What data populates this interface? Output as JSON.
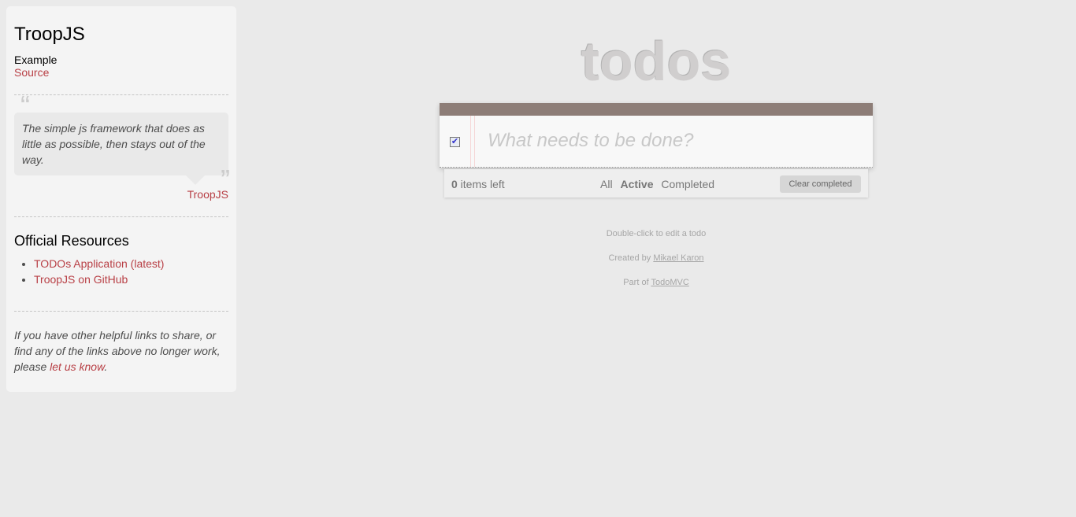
{
  "sidebar": {
    "title": "TroopJS",
    "example_label": "Example",
    "source_link": "Source",
    "quote": "The simple js framework that does as little as possible, then stays out of the way.",
    "quote_author": "TroopJS",
    "resources_heading": "Official Resources",
    "resources": [
      {
        "label": "TODOs Application (latest)"
      },
      {
        "label": "TroopJS on GitHub"
      }
    ],
    "footer_text": "If you have other helpful links to share, or find any of the links above no longer work, please ",
    "footer_link": "let us know",
    "footer_end": "."
  },
  "app": {
    "title": "todos",
    "placeholder": "What needs to be done?",
    "toggle_all_checked": true,
    "count": "0",
    "count_suffix": " items left",
    "filters": [
      "All",
      "Active",
      "Completed"
    ],
    "selected_filter": "Active",
    "clear_label": "Clear completed"
  },
  "info": {
    "hint": "Double-click to edit a todo",
    "created_by": "Created by ",
    "author": "Mikael Karon",
    "part_of": "Part of ",
    "todomvc": "TodoMVC"
  }
}
